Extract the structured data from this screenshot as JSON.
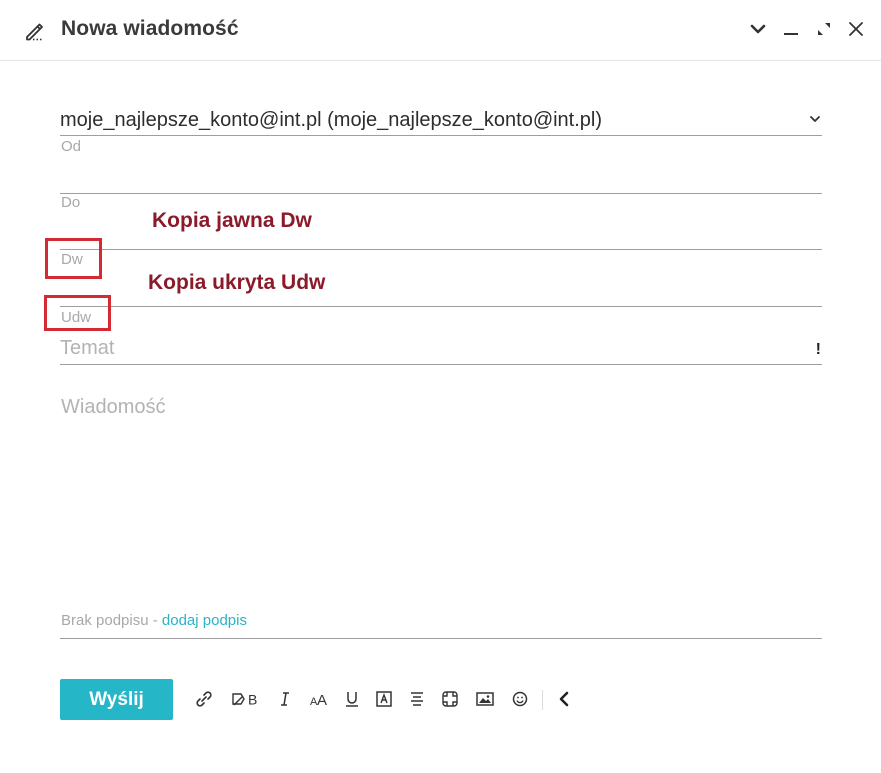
{
  "header": {
    "title": "Nowa wiadomość",
    "icons": [
      "compose-pencil-icon",
      "chevron-down-icon",
      "minimize-icon",
      "expand-icon",
      "close-icon"
    ]
  },
  "from": {
    "value": "moje_najlepsze_konto@int.pl (moje_najlepsze_konto@int.pl)",
    "label": "Od"
  },
  "to": {
    "label": "Do",
    "value": ""
  },
  "cc": {
    "label": "Dw",
    "value": ""
  },
  "bcc": {
    "label": "Udw",
    "value": ""
  },
  "subject": {
    "placeholder": "Temat",
    "importance_label": "!"
  },
  "message": {
    "placeholder": "Wiadomość"
  },
  "signature": {
    "text": "Brak podpisu - ",
    "link": "dodaj podpis"
  },
  "actions": {
    "send_label": "Wyślij"
  },
  "toolbar": {
    "items": [
      "link-icon",
      "signature-icon",
      "italic-icon",
      "font-size-icon",
      "underline-icon",
      "text-color-icon",
      "align-icon",
      "emoji-sticker-icon",
      "image-icon",
      "smiley-icon",
      "collapse-chevron-icon"
    ]
  },
  "annotations": {
    "cc": "Kopia jawna Dw",
    "bcc": "Kopia ukryta Udw"
  },
  "colors": {
    "accent": "#25b7c8",
    "link": "#2ab3c4",
    "annotation_text": "#8b1a2b",
    "annotation_box": "#d42a34"
  }
}
